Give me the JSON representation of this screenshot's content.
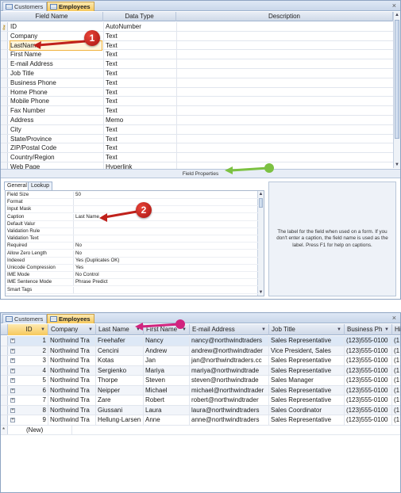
{
  "colors": {
    "accent": "#f6c85c",
    "callout_red": "#c0211b",
    "callout_green": "#7cc142",
    "callout_magenta": "#d1237e"
  },
  "design_view": {
    "tabs": [
      {
        "label": "Customers"
      },
      {
        "label": "Employees"
      }
    ],
    "close_glyph": "×",
    "columns": {
      "field_name": "Field Name",
      "data_type": "Data Type",
      "description": "Description"
    },
    "key_icon": "key-icon",
    "fields": [
      {
        "name": "ID",
        "type": "AutoNumber"
      },
      {
        "name": "Company",
        "type": "Text"
      },
      {
        "name": "LastName",
        "type": "Text"
      },
      {
        "name": "First Name",
        "type": "Text"
      },
      {
        "name": "E-mail Address",
        "type": "Text"
      },
      {
        "name": "Job Title",
        "type": "Text"
      },
      {
        "name": "Business Phone",
        "type": "Text"
      },
      {
        "name": "Home Phone",
        "type": "Text"
      },
      {
        "name": "Mobile Phone",
        "type": "Text"
      },
      {
        "name": "Fax Number",
        "type": "Text"
      },
      {
        "name": "Address",
        "type": "Memo"
      },
      {
        "name": "City",
        "type": "Text"
      },
      {
        "name": "State/Province",
        "type": "Text"
      },
      {
        "name": "ZIP/Postal Code",
        "type": "Text"
      },
      {
        "name": "Country/Region",
        "type": "Text"
      },
      {
        "name": "Web Page",
        "type": "Hyperlink"
      }
    ],
    "field_properties_label": "Field Properties",
    "property_tabs": [
      {
        "label": "General"
      },
      {
        "label": "Lookup"
      }
    ],
    "properties": [
      {
        "label": "Field Size",
        "value": "50"
      },
      {
        "label": "Format",
        "value": ""
      },
      {
        "label": "Input Mask",
        "value": ""
      },
      {
        "label": "Caption",
        "value": "Last Name"
      },
      {
        "label": "Default Valur",
        "value": ""
      },
      {
        "label": "Validation Rule",
        "value": ""
      },
      {
        "label": "Validation Text",
        "value": ""
      },
      {
        "label": "Required",
        "value": "No"
      },
      {
        "label": "Allow Zero Length",
        "value": "No"
      },
      {
        "label": "Indexed",
        "value": "Yes (Duplicates OK)"
      },
      {
        "label": "Unicode Compression",
        "value": "Yes"
      },
      {
        "label": "IME Mode",
        "value": "No Control"
      },
      {
        "label": "IME Sentence Mode",
        "value": "Phrase Predict"
      },
      {
        "label": "Smart Tags",
        "value": ""
      }
    ],
    "help_text": "The label for the field when used on a form. If you don't enter a caption, the field name is used as the label. Press F1 for help on captions."
  },
  "datasheet_view": {
    "tabs": [
      {
        "label": "Customers"
      },
      {
        "label": "Employees"
      }
    ],
    "close_glyph": "×",
    "columns": [
      {
        "label": "ID"
      },
      {
        "label": "Company"
      },
      {
        "label": "Last Name"
      },
      {
        "label": "First Name"
      },
      {
        "label": "E-mail Address"
      },
      {
        "label": "Job Title"
      },
      {
        "label": "Business Ph"
      },
      {
        "label": "Hi"
      }
    ],
    "rows": [
      {
        "id": "1",
        "company": "Northwind Tra",
        "last": "Freehafer",
        "first": "Nancy",
        "email": "nancy@northwindtraders",
        "job": "Sales Representative",
        "phone": "(123)555-0100",
        "home": "(1"
      },
      {
        "id": "2",
        "company": "Northwind Tra",
        "last": "Cencini",
        "first": "Andrew",
        "email": "andrew@northwindtrader",
        "job": "Vice President, Sales",
        "phone": "(123)555-0100",
        "home": "(1"
      },
      {
        "id": "3",
        "company": "Northwind Tra",
        "last": "Kotas",
        "first": "Jan",
        "email": "jan@northwindtraders.cc",
        "job": "Sales Representative",
        "phone": "(123)555-0100",
        "home": "(1"
      },
      {
        "id": "4",
        "company": "Northwind Tra",
        "last": "Sergienko",
        "first": "Mariya",
        "email": "mariya@northwindtrade",
        "job": "Sales Representative",
        "phone": "(123)555-0100",
        "home": "(1"
      },
      {
        "id": "5",
        "company": "Northwind Tra",
        "last": "Thorpe",
        "first": "Steven",
        "email": "steven@northwindtrade",
        "job": "Sales Manager",
        "phone": "(123)555-0100",
        "home": "(1"
      },
      {
        "id": "6",
        "company": "Northwind Tra",
        "last": "Neipper",
        "first": "Michael",
        "email": "michael@northwindtrader",
        "job": "Sales Representative",
        "phone": "(123)555-0100",
        "home": "(1"
      },
      {
        "id": "7",
        "company": "Northwind Tra",
        "last": "Zare",
        "first": "Robert",
        "email": "robert@northwindtrader",
        "job": "Sales Representative",
        "phone": "(123)555-0100",
        "home": "(1"
      },
      {
        "id": "8",
        "company": "Northwind Tra",
        "last": "Giussani",
        "first": "Laura",
        "email": "laura@northwindtraders",
        "job": "Sales Coordinator",
        "phone": "(123)555-0100",
        "home": "(1"
      },
      {
        "id": "9",
        "company": "Northwind Tra",
        "last": "Hellung-Larsen",
        "first": "Anne",
        "email": "anne@northwindtraders",
        "job": "Sales Representative",
        "phone": "(123)555-0100",
        "home": "(1"
      }
    ],
    "new_row_label": "(New)",
    "new_row_marker": "*"
  },
  "callouts": [
    {
      "number": "1"
    },
    {
      "number": "2"
    }
  ]
}
